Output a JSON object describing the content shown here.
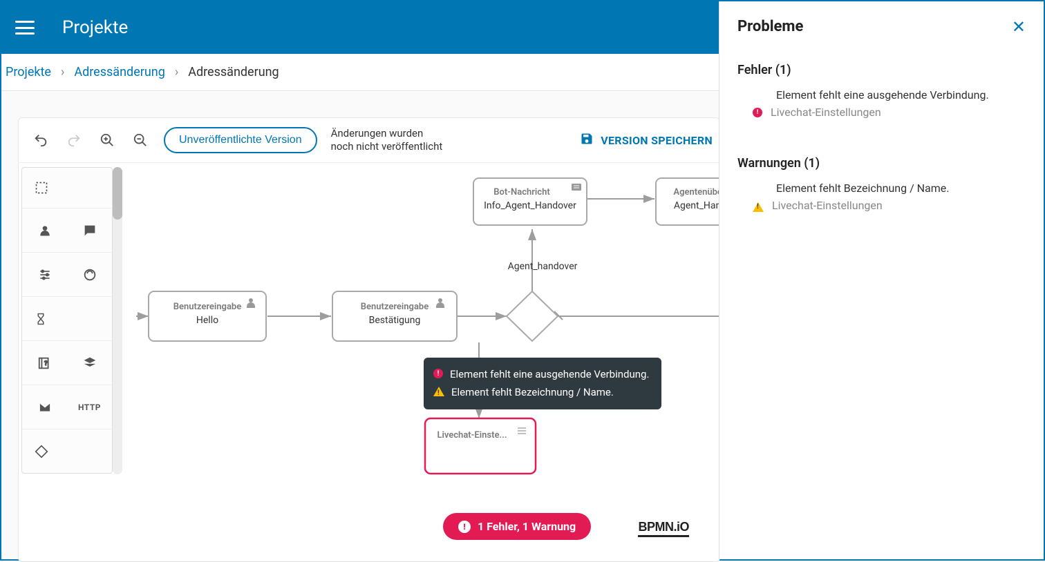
{
  "header": {
    "title": "Projekte"
  },
  "breadcrumbs": {
    "root": "Projekte",
    "mid": "Adressänderung",
    "current": "Adressänderung"
  },
  "toolbar": {
    "version_chip": "Unveröffentlichte Version",
    "status_text": "Änderungen wurden noch nicht veröffentlicht",
    "save_label": "VERSION SPEICHERN"
  },
  "palette": {
    "http_label": "HTTP"
  },
  "diagram": {
    "node_hello_title": "Benutzereingabe",
    "node_hello_sub": "Hello",
    "node_bestaetigung_title": "Benutzereingabe",
    "node_bestaetigung_sub": "Bestätigung",
    "node_bot_title": "Bot-Nachricht",
    "node_bot_sub": "Info_Agent_Handover",
    "node_agent_title": "Agentenüber",
    "node_agent_sub": "Agent_Hando",
    "gateway_label": "Agent_handover",
    "node_livechat_title": "Livechat-Einste...",
    "bpmn_logo": "BPMN.iO"
  },
  "tooltip": {
    "err": "Element fehlt eine ausgehende Verbindung.",
    "warn": "Element fehlt Bezeichnung / Name."
  },
  "status_pill": "1 Fehler, 1 Warnung",
  "side_panel": {
    "title": "Probleme",
    "errors_heading": "Fehler (1)",
    "error_msg": "Element fehlt eine ausgehende Verbindung.",
    "error_source": "Livechat-Einstellungen",
    "warnings_heading": "Warnungen (1)",
    "warning_msg": "Element fehlt Bezeichnung / Name.",
    "warning_source": "Livechat-Einstellungen"
  }
}
